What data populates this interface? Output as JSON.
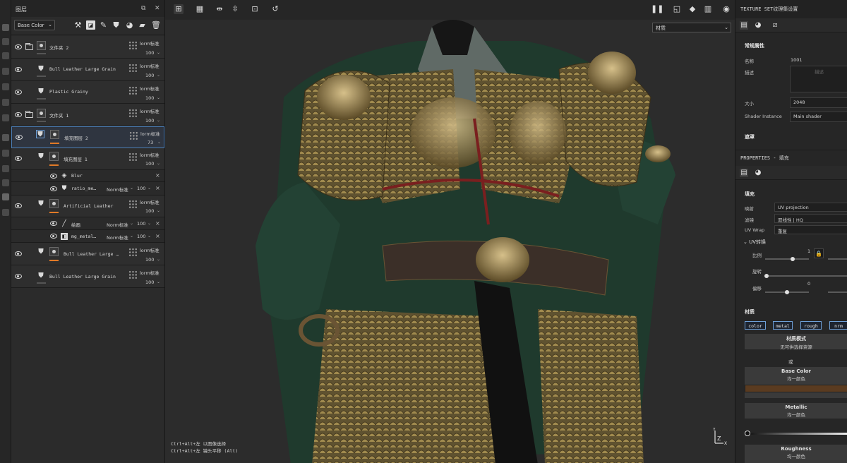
{
  "layers_panel": {
    "title": "图层",
    "channel": "Base Color",
    "layers": [
      {
        "name": "文件夹 2",
        "kind": "folder",
        "blend": "lorm标准",
        "opacity": "100"
      },
      {
        "name": "Bull Leather Large Grain",
        "kind": "fill",
        "blend": "lorm标准",
        "opacity": "100"
      },
      {
        "name": "Plastic Grainy",
        "kind": "fill",
        "blend": "lorm标准",
        "opacity": "100"
      },
      {
        "name": "文件夹 1",
        "kind": "folder",
        "blend": "lorm标准",
        "opacity": "100"
      },
      {
        "name": "填充图层 2",
        "kind": "fill",
        "blend": "lorm标准",
        "opacity": "73",
        "selected": true
      },
      {
        "name": "填充图层 1",
        "kind": "fill",
        "blend": "lorm标准",
        "opacity": "100"
      },
      {
        "name": "Blur",
        "kind": "effect"
      },
      {
        "name": "ratio_me…",
        "kind": "effect",
        "blend": "Norm标准",
        "opacity": "100"
      },
      {
        "name": "Artificial Leather",
        "kind": "fill",
        "blend": "lorm标准",
        "opacity": "100"
      },
      {
        "name": "绘画",
        "kind": "effect",
        "blend": "Norm标准",
        "opacity": "100"
      },
      {
        "name": "mg_metal…",
        "kind": "effect",
        "blend": "Norm标准",
        "opacity": "100"
      },
      {
        "name": "Bull Leather Large …",
        "kind": "fill",
        "blend": "lorm标准",
        "opacity": "100"
      },
      {
        "name": "Bull Leather Large Grain",
        "kind": "fill",
        "blend": "lorm标准",
        "opacity": "100"
      }
    ]
  },
  "viewport": {
    "material_selector": "材质",
    "hints": [
      "Ctrl+Alt+左 以图像选择",
      "Ctrl+Alt+左 镜头平移 (Alt)"
    ]
  },
  "texture_set": {
    "title": "TEXTURE SET纹理集设置",
    "general_header": "常规属性",
    "name_label": "名称",
    "name_value": "1001",
    "desc_label": "描述",
    "desc_placeholder": "描述",
    "size_label": "大小",
    "size_value": "2048",
    "shader_label": "Shader Instance",
    "shader_value": "Main shader",
    "mask_header": "遮罩"
  },
  "properties": {
    "title": "PROPERTIES - 填充",
    "fill_header": "填充",
    "mapping_label": "映射",
    "mapping_value": "UV projection",
    "filter_label": "滤镜",
    "filter_value": "双线性 | HQ",
    "uvwrap_label": "UV Wrap",
    "uvwrap_value": "重复",
    "uv_transform": "UV转换",
    "scale_label": "比例",
    "scale_value": "1",
    "rotate_label": "旋转",
    "offset_label": "偏移",
    "offset_value": "0",
    "material_header": "材质",
    "channels": [
      "color",
      "metal",
      "rough",
      "nrm"
    ],
    "material_mode": "材质模式",
    "material_mode_sub": "无可供选择资源",
    "or_label": "或",
    "base_color_label": "Base Color",
    "uniform": "均一颜色",
    "base_color_hex": "#5a3b20",
    "metallic_label": "Metallic",
    "metallic_level": 0.0,
    "roughness_label": "Roughness"
  }
}
